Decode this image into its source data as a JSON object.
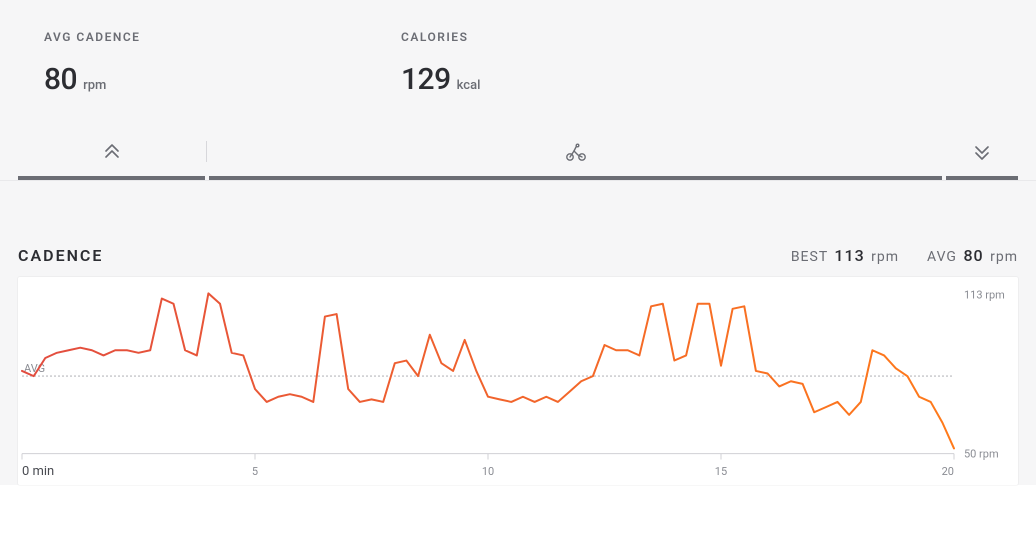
{
  "summary": {
    "cadence": {
      "label": "AVG CADENCE",
      "value": "80",
      "unit": "rpm"
    },
    "calories": {
      "label": "CALORIES",
      "value": "129",
      "unit": "kcal"
    }
  },
  "chart_section": {
    "title": "CADENCE",
    "best_label": "BEST",
    "best_value": "113",
    "best_unit": "rpm",
    "avg_label": "AVG",
    "avg_value": "80",
    "avg_unit": "rpm"
  },
  "chart_labels": {
    "avg_tag": "AVG",
    "ytick_high": "113 rpm",
    "ytick_low": "50 rpm",
    "xtick0": "0 min"
  },
  "chart_data": {
    "type": "line",
    "title": "Cadence",
    "xlabel": "min",
    "ylabel": "rpm",
    "average": 80,
    "ylim": [
      50,
      113
    ],
    "xlim": [
      0,
      20
    ],
    "xticks": [
      0,
      5,
      10,
      15,
      20
    ],
    "series": [
      {
        "name": "Cadence",
        "color_start": "#e24c3f",
        "color_end": "#ff7a1a",
        "x": [
          0.0,
          0.25,
          0.5,
          0.75,
          1.0,
          1.25,
          1.5,
          1.75,
          2.0,
          2.25,
          2.5,
          2.75,
          3.0,
          3.25,
          3.5,
          3.75,
          4.0,
          4.25,
          4.5,
          4.75,
          5.0,
          5.25,
          5.5,
          5.75,
          6.0,
          6.25,
          6.5,
          6.75,
          7.0,
          7.25,
          7.5,
          7.75,
          8.0,
          8.25,
          8.5,
          8.75,
          9.0,
          9.25,
          9.5,
          9.75,
          10.0,
          10.25,
          10.5,
          10.75,
          11.0,
          11.25,
          11.5,
          11.75,
          12.0,
          12.25,
          12.5,
          12.75,
          13.0,
          13.25,
          13.5,
          13.75,
          14.0,
          14.25,
          14.5,
          14.75,
          15.0,
          15.25,
          15.5,
          15.75,
          16.0,
          16.25,
          16.5,
          16.75,
          17.0,
          17.25,
          17.5,
          17.75,
          18.0,
          18.25,
          18.5,
          18.75,
          19.0,
          19.25,
          19.5,
          19.75,
          20.0
        ],
        "values": [
          82,
          80,
          87,
          89,
          90,
          91,
          90,
          88,
          90,
          90,
          89,
          90,
          110,
          108,
          90,
          88,
          112,
          108,
          89,
          88,
          75,
          70,
          72,
          73,
          72,
          70,
          103,
          104,
          75,
          70,
          71,
          70,
          85,
          86,
          80,
          96,
          85,
          82,
          94,
          82,
          72,
          71,
          70,
          72,
          70,
          72,
          70,
          74,
          78,
          80,
          92,
          90,
          90,
          88,
          107,
          108,
          86,
          88,
          108,
          108,
          84,
          106,
          107,
          82,
          81,
          76,
          78,
          77,
          66,
          68,
          70,
          65,
          70,
          90,
          88,
          83,
          80,
          72,
          70,
          62,
          52
        ]
      }
    ]
  }
}
